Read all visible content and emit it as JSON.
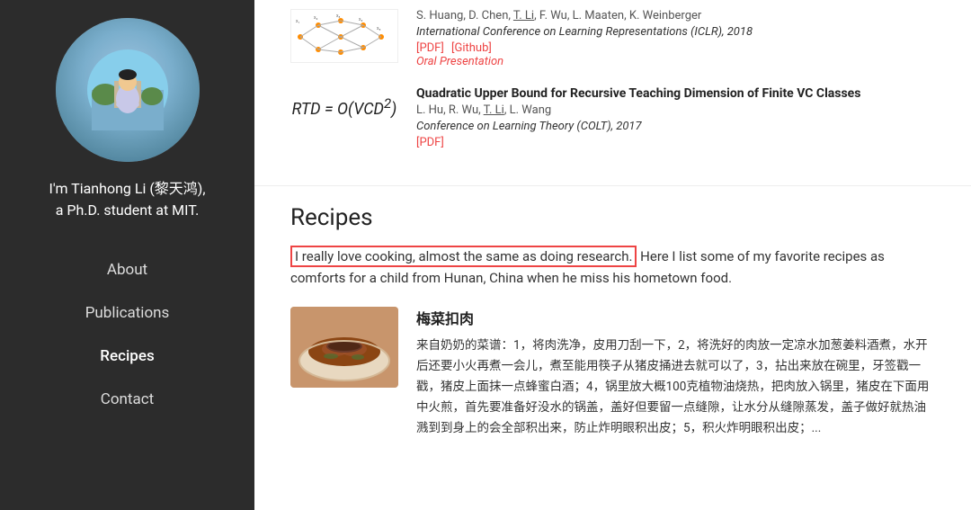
{
  "sidebar": {
    "name_line1": "I'm Tianhong Li (黎天鸿),",
    "name_line2": "a Ph.D. student at MIT.",
    "nav_items": [
      {
        "id": "about",
        "label": "About",
        "active": false
      },
      {
        "id": "publications",
        "label": "Publications",
        "active": false
      },
      {
        "id": "recipes",
        "label": "Recipes",
        "active": true
      },
      {
        "id": "contact",
        "label": "Contact",
        "active": false
      }
    ]
  },
  "publications": {
    "entries": [
      {
        "authors": "S. Huang, D. Chen, T. Li, F. Wu, L. Maaten, K. Weinberger",
        "underlined_author": "T. Li",
        "title": "International Conference on Learning Representations (ICLR), 2018",
        "links": [
          "[PDF]",
          "[Github]"
        ],
        "tag": "Oral Presentation"
      },
      {
        "formula": "RTD = O(VCD²)",
        "title_main": "Quadratic Upper Bound for Recursive Teaching Dimension of Finite VC Classes",
        "authors": "L. Hu, R. Wu, T. Li, L. Wang",
        "underlined_author": "T. Li",
        "venue": "Conference on Learning Theory (COLT), 2017",
        "links": [
          "[PDF]"
        ]
      }
    ]
  },
  "recipes": {
    "section_title": "Recipes",
    "intro_highlighted": "I really love cooking, almost the same as doing research.",
    "intro_rest": " Here I list some of my favorite recipes as comforts for a child from Hunan, China when he miss his hometown food.",
    "recipe_title": "梅菜扣肉",
    "recipe_text": "来自奶奶的菜谱：1，将肉洗净，皮用刀刮一下，2，将洗好的肉放一定凉水加葱姜料酒煮，水开后还要小火再煮一会儿，煮至能用筷子从猪皮捅进去就可以了，3，拈出来放在碗里，牙签戳一戳，猪皮上面抹一点蜂蜜白酒；4，锅里放大概100克植物油烧热，把肉放入锅里，猪皮在下面用中火煎，首先要准备好没水的锅盖，盖好但要留一点缝隙，让水分从缝隙蒸发，盖子做好就热油溅到到身上的会全部积出来，防止炸明眼积出皮；5，积火炸明眼积出皮；..."
  }
}
